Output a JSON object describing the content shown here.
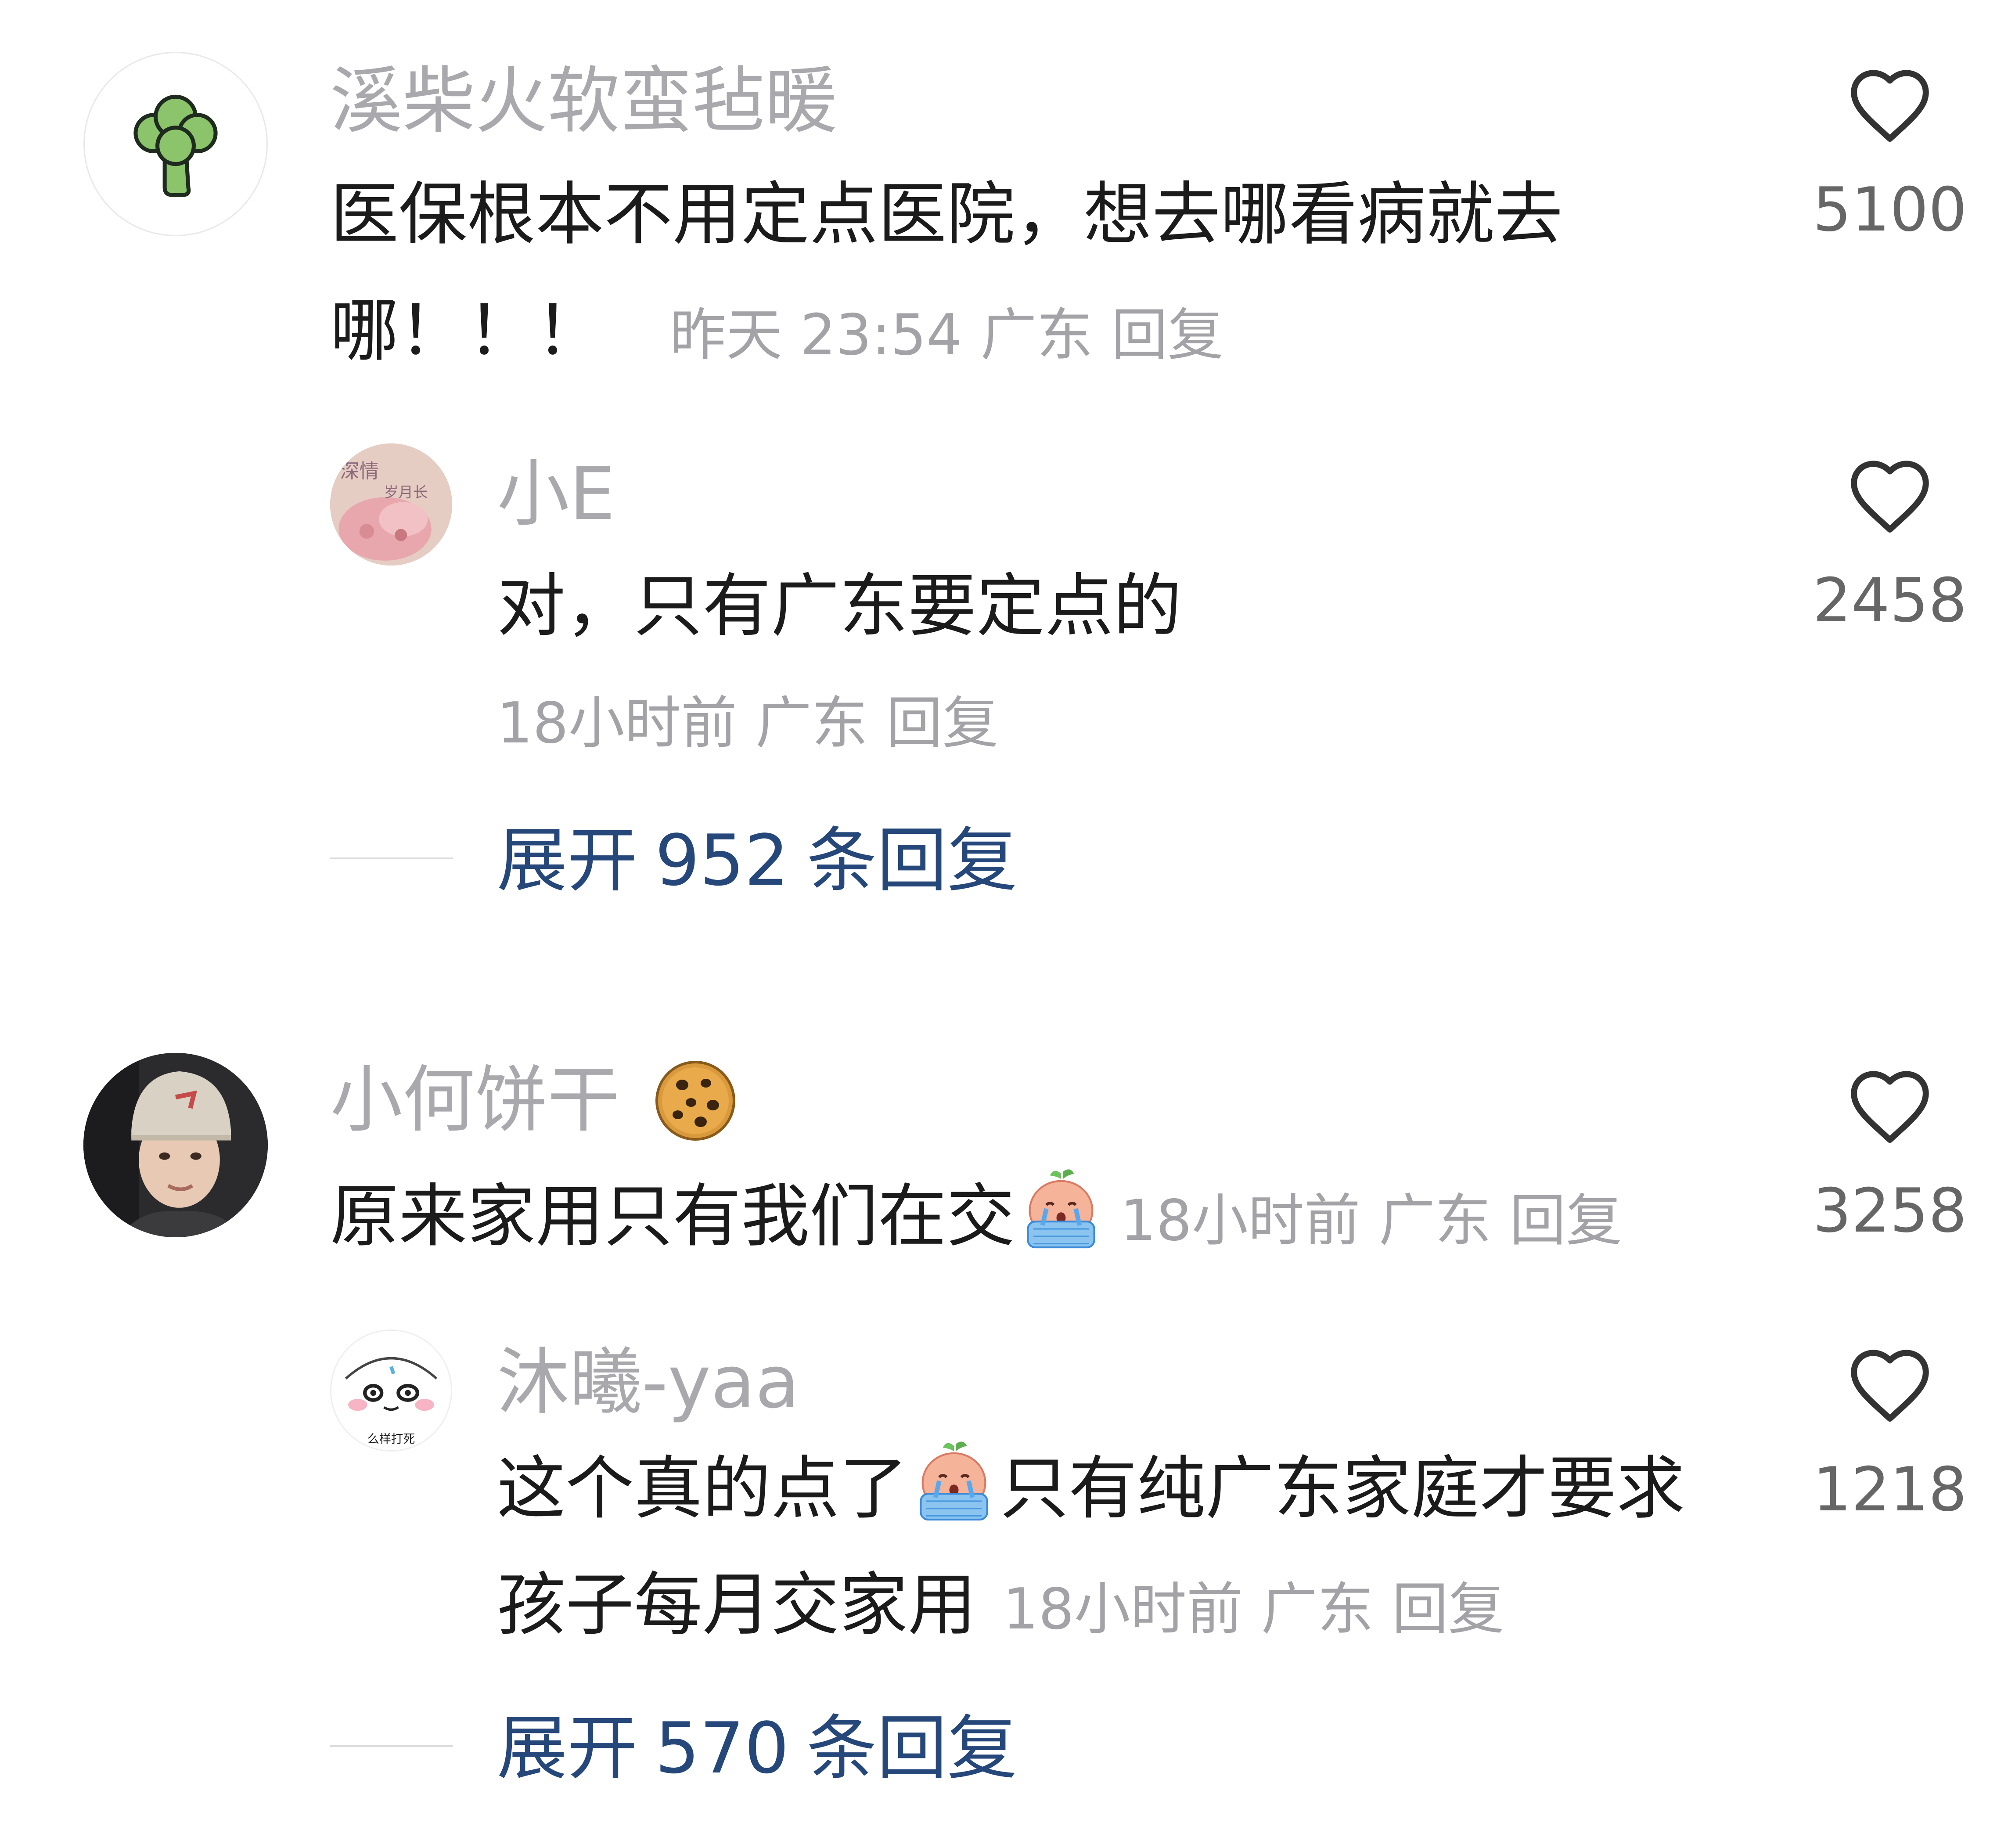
{
  "comments": [
    {
      "username": "溪柴火软蛮毡暖",
      "text_line1": "医保根本不用定点医院，想去哪看病就去",
      "text_line2": "哪！！！",
      "time": "昨天 23:54",
      "location": "广东",
      "reply_label": "回复",
      "likes": "5100",
      "avatar_icon": "broccoli-icon",
      "replies": [
        {
          "username": "小E",
          "text": "对，只有广东要定点的",
          "time": "18小时前",
          "location": "广东",
          "reply_label": "回复",
          "likes": "2458",
          "avatar_icon": "pink-photo-avatar"
        }
      ],
      "expand_label": "展开",
      "expand_count": "952",
      "expand_suffix": "条回复"
    },
    {
      "username": "小何饼干",
      "username_emoji": "cookie-icon",
      "text": "原来家用只有我们在交",
      "text_emoji": "crying-emoji",
      "time": "18小时前",
      "location": "广东",
      "reply_label": "回复",
      "likes": "3258",
      "avatar_icon": "person-photo-avatar",
      "replies": [
        {
          "username": "沐曦-yaa",
          "text_part1": "这个真的点了",
          "text_emoji": "crying-emoji",
          "text_part2": "只有纯广东家庭才要求",
          "text_line2": "孩子每月交家用",
          "time": "18小时前",
          "location": "广东",
          "reply_label": "回复",
          "likes": "1218",
          "avatar_icon": "cartoon-face-avatar"
        }
      ],
      "expand_label": "展开",
      "expand_count": "570",
      "expand_suffix": "条回复"
    }
  ],
  "colors": {
    "username": "#a9a9ad",
    "meta": "#a3a3a7",
    "expand": "#25477a",
    "text": "#1b1b1b"
  }
}
